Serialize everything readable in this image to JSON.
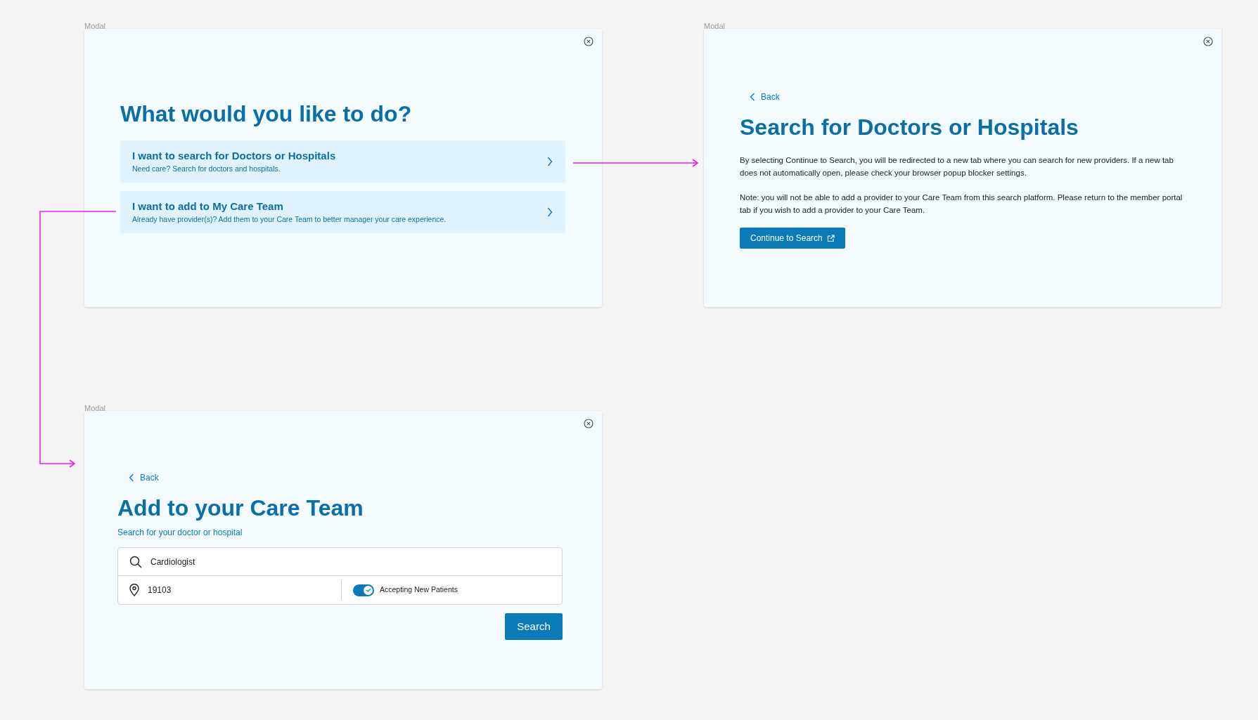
{
  "frames": [
    {
      "kind": "choice",
      "label": "Modal",
      "heading": "What would you like to do?",
      "options": [
        {
          "title": "I want to search for Doctors or Hospitals",
          "description": "Need care? Search for doctors and hospitals."
        },
        {
          "title": "I want to add to My Care Team",
          "description": "Already have provider(s)? Add them to your Care Team to better manager your care experience."
        }
      ]
    },
    {
      "kind": "info",
      "label": "Modal",
      "back": "Back",
      "heading": "Search for Doctors or Hospitals",
      "paragraphs": [
        "By selecting Continue to Search, you will be redirected to a new tab where you can search for new providers. If a new tab does not automatically open, please check your browser popup blocker settings.",
        "Note: you will not be able to add a provider to your Care Team from this search platform. Please return to the member portal tab if you wish to add a provider to your Care Team."
      ],
      "button": "Continue to Search"
    },
    {
      "kind": "search",
      "label": "Modal",
      "back": "Back",
      "heading": "Add to your Care Team",
      "subheading": "Search for your doctor or hospital",
      "query": "Cardiologist",
      "location": "19103",
      "toggle": {
        "label": "Accepting New Patients",
        "on": true
      },
      "button": "Search"
    }
  ]
}
